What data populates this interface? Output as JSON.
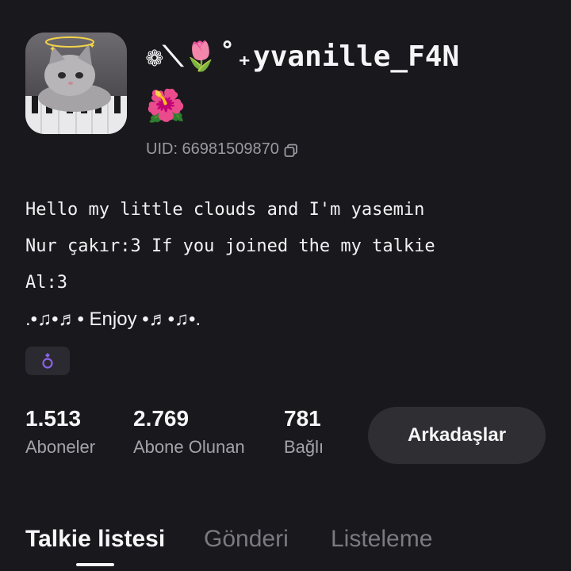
{
  "profile": {
    "username": "❁⟍🌷˚₊yvanille_F4N",
    "emoji_line": "🌺",
    "uid_text": "UID: 66981509870",
    "avatar_icon": "cat-avatar"
  },
  "bio": {
    "line1": "Hello my little clouds and I'm yasemin",
    "line2": "Nur çakır:3 If you joined the my talkie",
    "line3": "Al:3",
    "line4": ".•♫•♬• Enjoy •♬•♫•."
  },
  "badge": {
    "icon": "ring-badge-icon",
    "color": "#8a63e6"
  },
  "stats": [
    {
      "value": "1.513",
      "label": "Aboneler"
    },
    {
      "value": "2.769",
      "label": "Abone Olunan"
    },
    {
      "value": "781",
      "label": "Bağlı"
    }
  ],
  "friends_button": {
    "label": "Arkadaşlar"
  },
  "tabs": [
    {
      "label": "Talkie listesi",
      "active": true
    },
    {
      "label": "Gönderi",
      "active": false
    },
    {
      "label": "Listeleme",
      "active": false
    }
  ],
  "colors": {
    "background": "#19181c",
    "text": "#f2f2f4",
    "muted": "#9b9aa1",
    "button_bg": "#2f2e33"
  }
}
